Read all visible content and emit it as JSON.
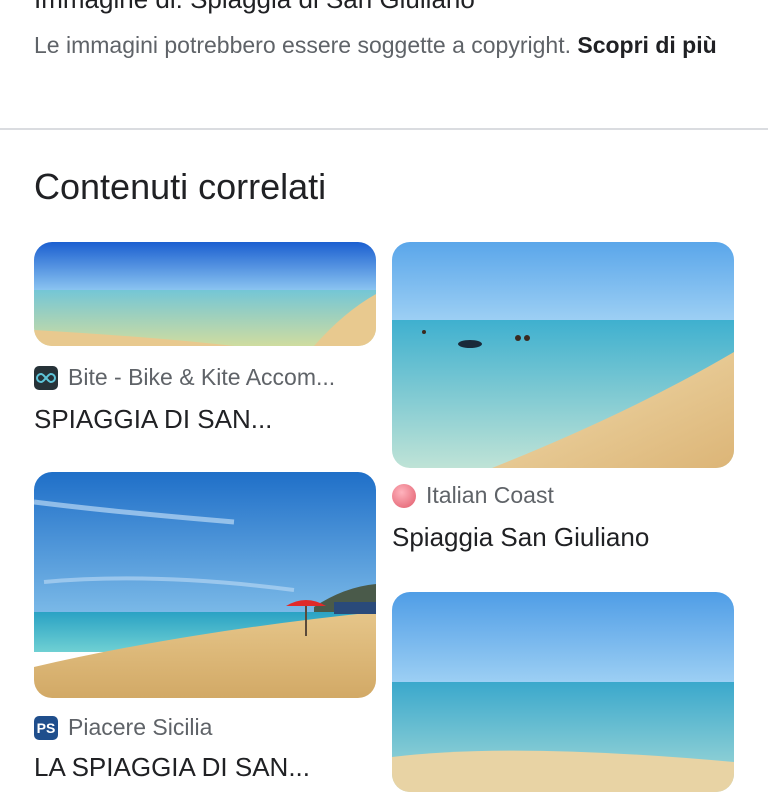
{
  "top_cut_text": "Immagine di: Spiaggia di San Giuliano",
  "copyright": {
    "text": "Le immagini potrebbero essere soggette a copyright. ",
    "link": "Scopri di più"
  },
  "related": {
    "title": "Contenuti correlati",
    "cards": [
      {
        "source": "Bite - Bike & Kite Accom...",
        "source_icon": "infinity-logo-icon",
        "title": "SPIAGGIA DI SAN..."
      },
      {
        "source": "Italian Coast",
        "source_icon": "pink-sphere-logo-icon",
        "title": "Spiaggia San Giuliano"
      },
      {
        "source": "Piacere Sicilia",
        "source_icon_text": "PS",
        "title": "LA SPIAGGIA DI SAN..."
      }
    ]
  },
  "colors": {
    "sky": "#2f7fd6",
    "sea": "#5ec4d8",
    "sand": "#e7cc92",
    "ps_icon": "#1f4e8c",
    "italian_coast": "#e05a6a"
  }
}
